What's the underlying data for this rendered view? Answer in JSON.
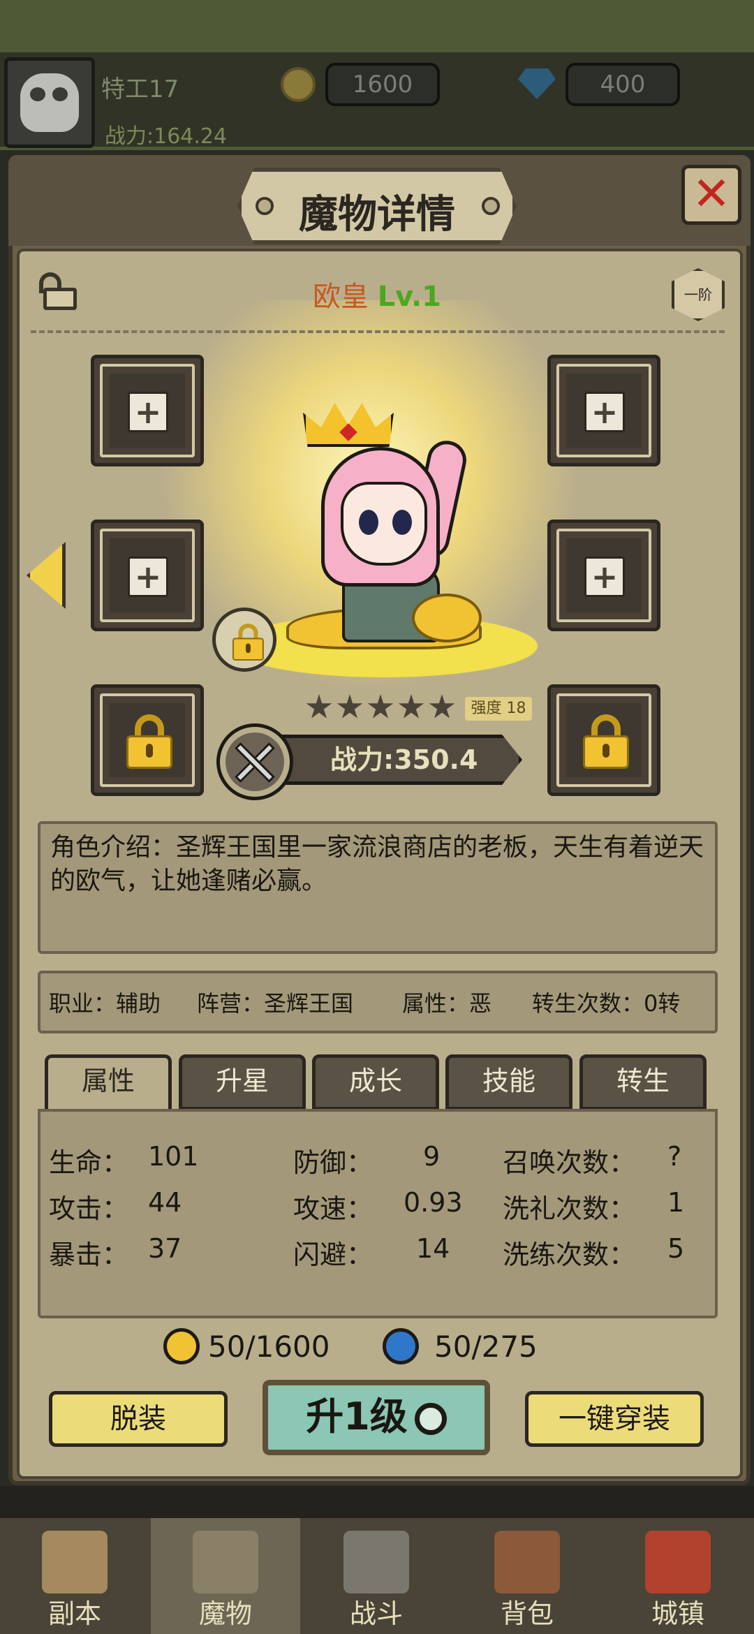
{
  "player": {
    "name": "特工17",
    "power": "战力:164.24",
    "coins": "1600",
    "gems": "400"
  },
  "panel": {
    "title": "魔物详情",
    "close": "✕",
    "rank": "一阶"
  },
  "hero": {
    "name": "欧皇",
    "level": "Lv.1",
    "stars": 5,
    "strength_label": "强度",
    "strength_value": "18",
    "power": "战力:350.4"
  },
  "description": "角色介绍：圣辉王国里一家流浪商店的老板，天生有着逆天的欧气，让她逢赌必赢。",
  "info": {
    "job": "职业：辅助",
    "faction": "阵营：圣辉王国",
    "attribute": "属性：恶",
    "rebirth": "转生次数：0转"
  },
  "tabs": [
    "属性",
    "升星",
    "成长",
    "技能",
    "转生"
  ],
  "active_tab": "属性",
  "stats": {
    "hp_label": "生命：",
    "hp": "101",
    "atk_label": "攻击：",
    "atk": "44",
    "crit_label": "暴击：",
    "crit": "37",
    "def_label": "防御：",
    "def": "9",
    "spd_label": "攻速：",
    "spd": "0.93",
    "dodge_label": "闪避：",
    "dodge": "14",
    "summon_label": "召唤次数：",
    "summon": "?",
    "baptize_label": "洗礼次数：",
    "baptize": "1",
    "refine_label": "洗练次数：",
    "refine": "5"
  },
  "cost": {
    "gold": "50/1600",
    "essence": "50/275"
  },
  "buttons": {
    "unequip": "脱装",
    "levelup": "升1级",
    "equip_all": "一键穿装"
  },
  "nav": [
    {
      "label": "副本",
      "icon": "map-icon"
    },
    {
      "label": "魔物",
      "icon": "monster-icon"
    },
    {
      "label": "战斗",
      "icon": "swords-icon"
    },
    {
      "label": "背包",
      "icon": "backpack-icon"
    },
    {
      "label": "城镇",
      "icon": "shop-icon"
    }
  ],
  "colors": {
    "accent_green": "#4aa81d",
    "hero_name": "#c8571f",
    "close_red": "#c0261f",
    "panel": "#b9ae8c"
  }
}
